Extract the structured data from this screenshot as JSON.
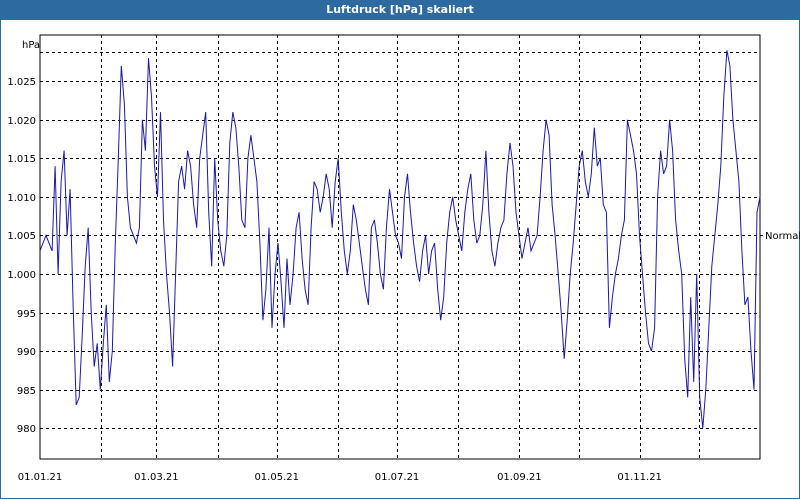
{
  "window": {
    "title": "Luftdruck [hPa] skaliert"
  },
  "chart_data": {
    "type": "line",
    "title": "Luftdruck [hPa] skaliert",
    "ylabel": "hPa",
    "xlabel": "",
    "ylim": [
      976,
      1031
    ],
    "x_range": [
      "01.01.21",
      "31.12.21"
    ],
    "grid": true,
    "yticks": [
      980,
      985,
      990,
      995,
      1000,
      1005,
      1010,
      1015,
      1020,
      1025
    ],
    "ytick_labels": [
      "980",
      "985",
      "990",
      "995",
      "1.000",
      "1.005",
      "1.010",
      "1.015",
      "1.020",
      "1.025"
    ],
    "xtick_labels": [
      "01.01.21",
      "01.03.21",
      "01.05.21",
      "01.07.21",
      "01.09.21",
      "01.11.21"
    ],
    "reference_line": {
      "label": "Normal",
      "value": 1005
    },
    "series": [
      {
        "color": "#1a1aa8",
        "x_start": "01.01.21",
        "values": [
          1003,
          1004,
          1005,
          1004,
          1003,
          1014,
          1000,
          1012,
          1016,
          1005,
          1011,
          996,
          983,
          984,
          992,
          1001,
          1006,
          995,
          988,
          991,
          985,
          991,
          996,
          986,
          990,
          1004,
          1015,
          1027,
          1022,
          1010,
          1006,
          1005,
          1004,
          1006,
          1020,
          1016,
          1028,
          1023,
          1014,
          1010,
          1021,
          1007,
          1000,
          995,
          988,
          1000,
          1012,
          1014,
          1011,
          1016,
          1014,
          1009,
          1006,
          1015,
          1018,
          1021,
          1008,
          1001,
          1015,
          1007,
          1003,
          1001,
          1005,
          1017,
          1021,
          1019,
          1014,
          1007,
          1006,
          1015,
          1018,
          1015,
          1012,
          1004,
          994,
          998,
          1006,
          993,
          1000,
          1004,
          999,
          993,
          1002,
          996,
          1000,
          1006,
          1008,
          1002,
          998,
          996,
          1006,
          1012,
          1011,
          1008,
          1010,
          1013,
          1011,
          1006,
          1012,
          1015,
          1008,
          1003,
          1000,
          1003,
          1009,
          1007,
          1004,
          1001,
          998,
          996,
          1006,
          1007,
          1004,
          1000,
          998,
          1006,
          1011,
          1008,
          1005,
          1004,
          1002,
          1010,
          1013,
          1008,
          1004,
          1001,
          999,
          1003,
          1005,
          1000,
          1003,
          1004,
          998,
          994,
          997,
          1004,
          1008,
          1010,
          1007,
          1005,
          1003,
          1008,
          1011,
          1013,
          1007,
          1004,
          1005,
          1009,
          1016,
          1008,
          1003,
          1001,
          1004,
          1006,
          1007,
          1013,
          1017,
          1014,
          1008,
          1005,
          1002,
          1004,
          1006,
          1003,
          1004,
          1005,
          1010,
          1016,
          1020,
          1018,
          1009,
          1005,
          1000,
          995,
          989,
          994,
          1000,
          1004,
          1009,
          1014,
          1016,
          1012,
          1010,
          1013,
          1019,
          1014,
          1015,
          1009,
          1008,
          993,
          997,
          1000,
          1002,
          1005,
          1007,
          1020,
          1018,
          1016,
          1013,
          1005,
          1000,
          995,
          991,
          990,
          993,
          1010,
          1016,
          1013,
          1014,
          1020,
          1016,
          1007,
          1003,
          1000,
          989,
          984,
          997,
          986,
          1000,
          984,
          980,
          985,
          993,
          1001,
          1005,
          1009,
          1014,
          1023,
          1029,
          1027,
          1020,
          1016,
          1012,
          1003,
          996,
          997,
          990,
          985,
          1008,
          1010
        ]
      }
    ]
  }
}
